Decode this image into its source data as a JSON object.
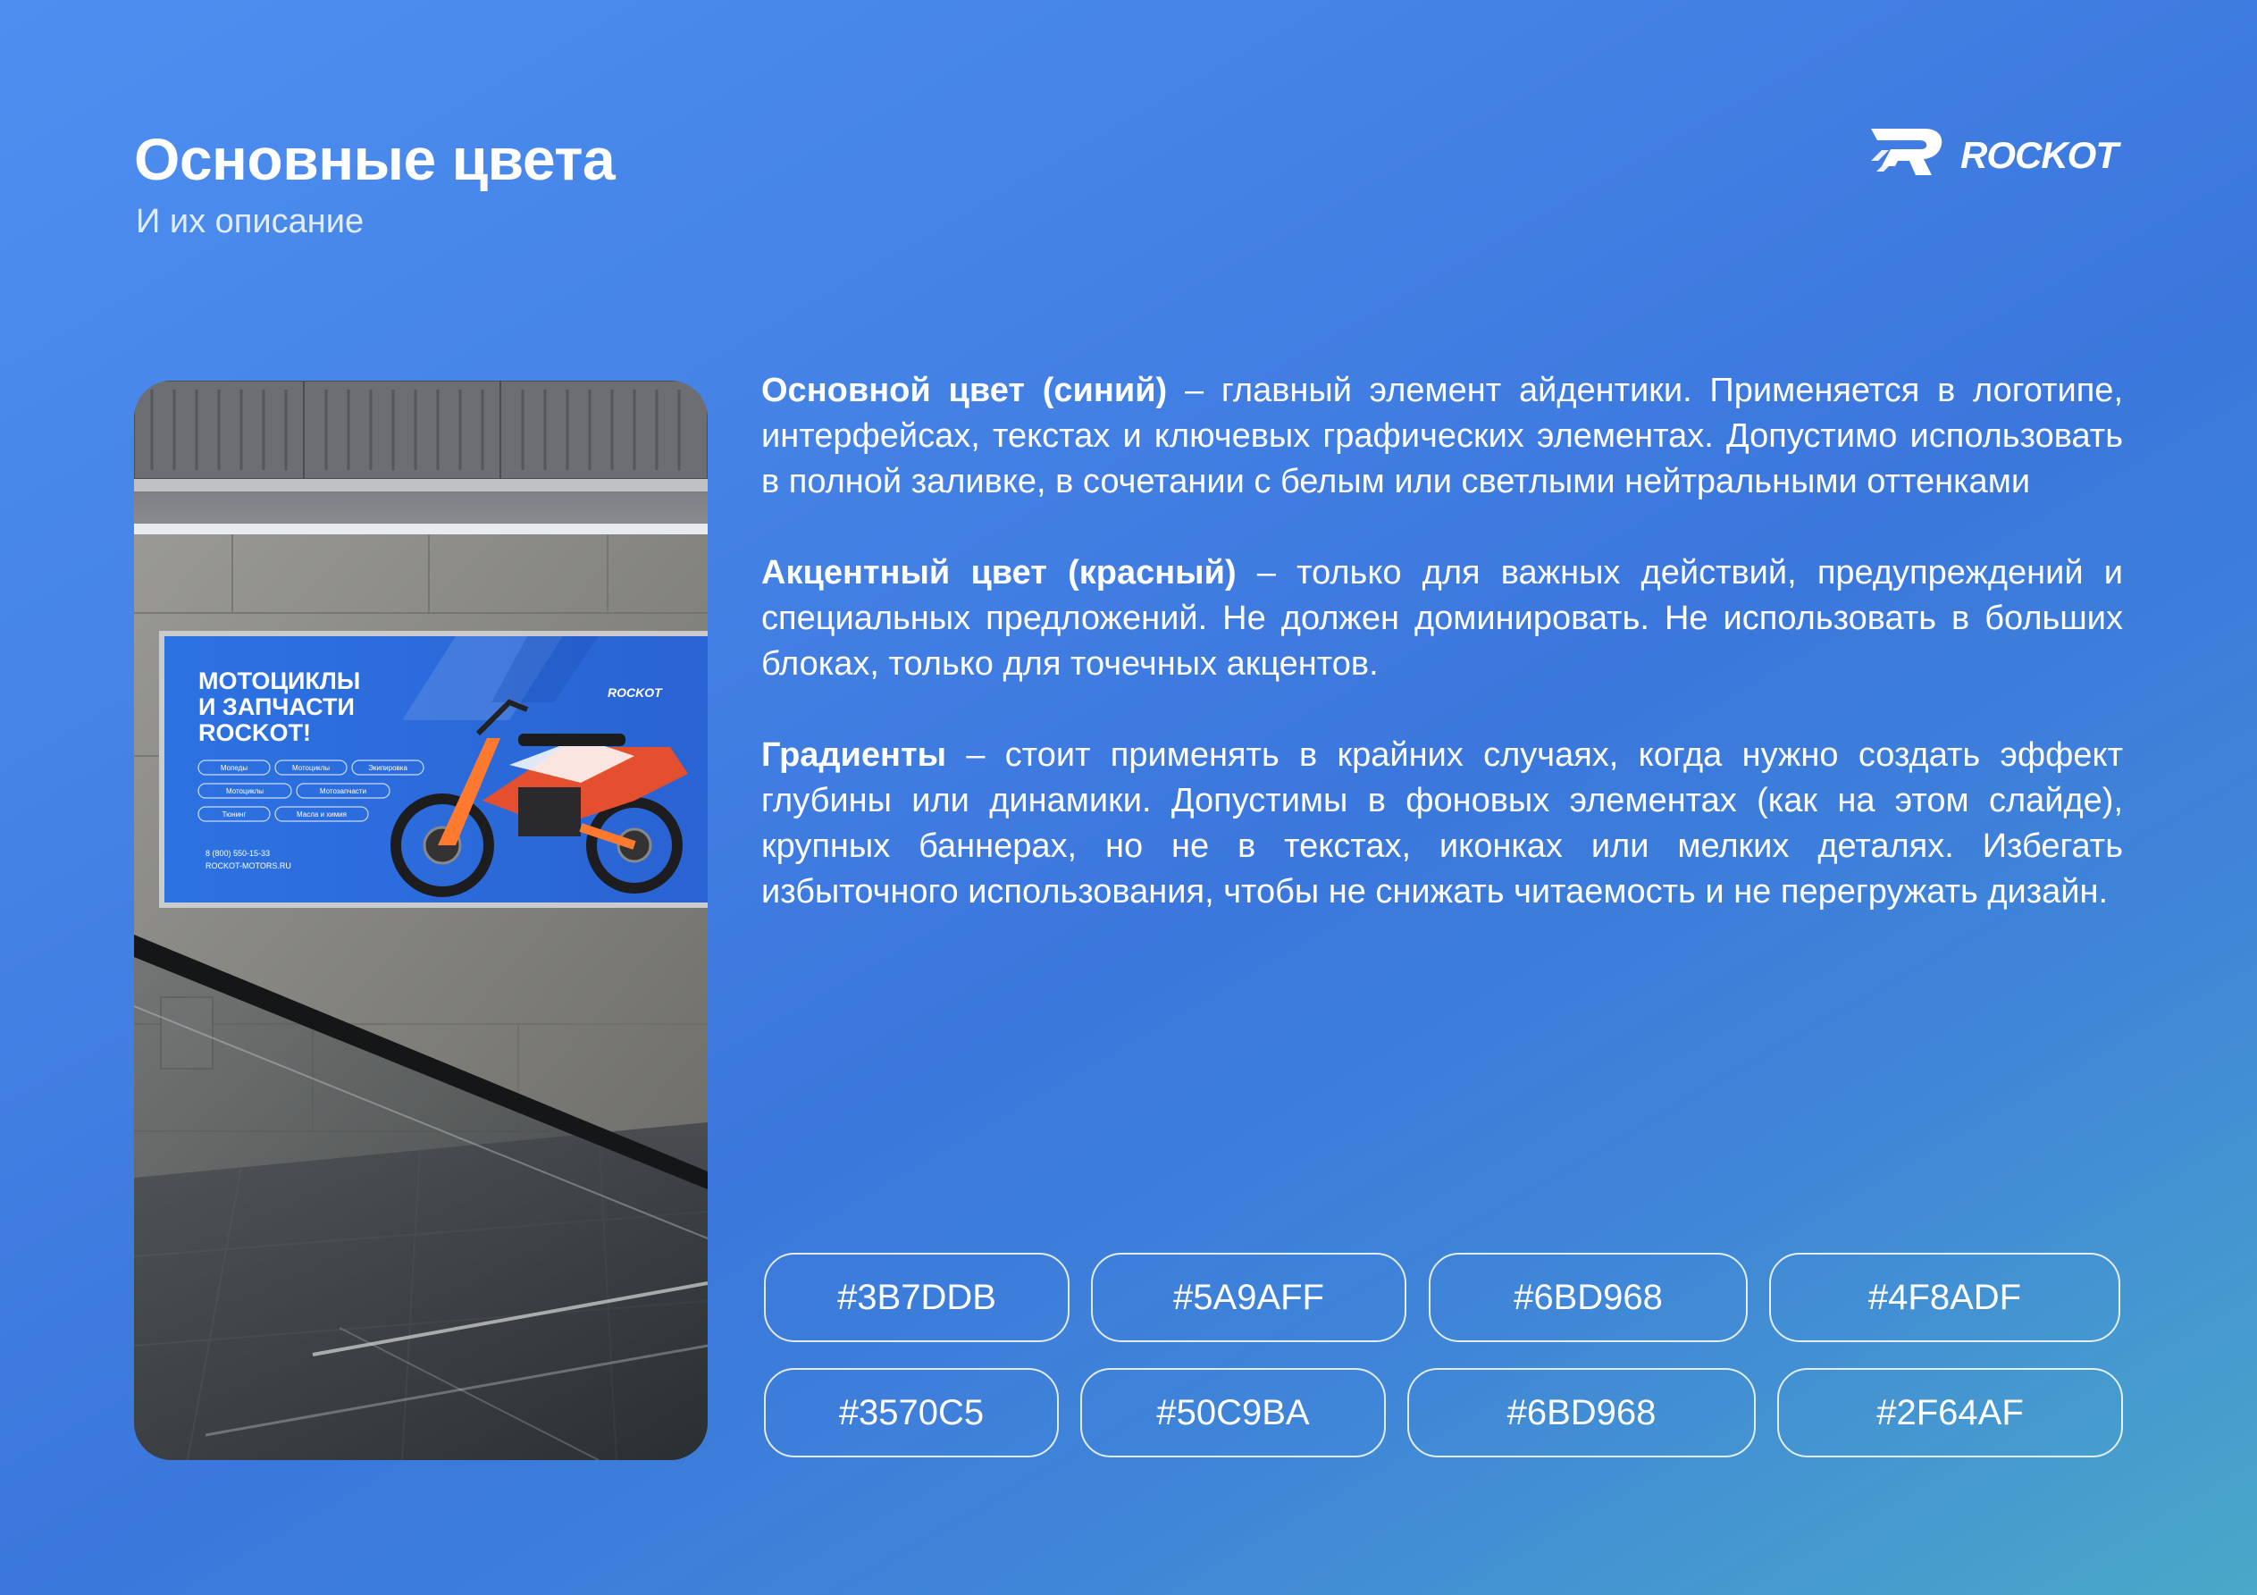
{
  "header": {
    "title": "Основные цвета",
    "subtitle": "И их описание",
    "logo_text": "ROCKOT"
  },
  "photo": {
    "billboard_headline": [
      "МОТОЦИКЛЫ",
      "И ЗАПЧАСТИ",
      "ROCKOT!"
    ],
    "billboard_logo": "ROCKOT",
    "billboard_buttons": [
      "Мопеды",
      "Мотоциклы",
      "Экипировка",
      "Мотоциклы",
      "Мотозапчасти",
      "Тюнинг",
      "Масла и химия"
    ],
    "billboard_phone": "8 (800) 550-15-33",
    "billboard_site": "ROCKOT-MOTORS.RU",
    "colors": {
      "billboard_blue": "#2b6fe0",
      "bike_red": "#e4502f"
    }
  },
  "content": {
    "primary": {
      "term": "Основной цвет (синий)",
      "text": " – главный элемент айдентики. Применяется в логотипе, интерфейсах, текстах и ключевых графических элементах. Допустимо использовать в полной заливке, в сочетании с белым или светлыми нейтральными оттенками"
    },
    "accent": {
      "term": "Акцентный цвет (красный)",
      "text": " – только для важных действий, предупреждений и специальных предложений. Не должен доминировать. Не использовать в больших блоках, только для точечных акцентов."
    },
    "gradients": {
      "term": "Градиенты",
      "text": " – стоит применять в крайних случаях, когда нужно создать эффект глубины или динамики. Допустимы в фоновых элементах (как на этом слайде), крупных баннерах, но не в текстах, иконках или мелких деталях. Избегать избыточного использования, чтобы не снижать читаемость и не перегружать дизайн."
    }
  },
  "swatches": [
    {
      "label": "#3B7DDB"
    },
    {
      "label": "#5A9AFF"
    },
    {
      "label": "#6BD968"
    },
    {
      "label": "#4F8ADF"
    },
    {
      "label": "#3570C5"
    },
    {
      "label": "#50C9BA"
    },
    {
      "label": "#6BD968"
    },
    {
      "label": "#2F64AF"
    }
  ],
  "theme": {
    "background_start": "#4d8ff0",
    "background_end": "#4aa8c8",
    "text": "#ffffff"
  }
}
